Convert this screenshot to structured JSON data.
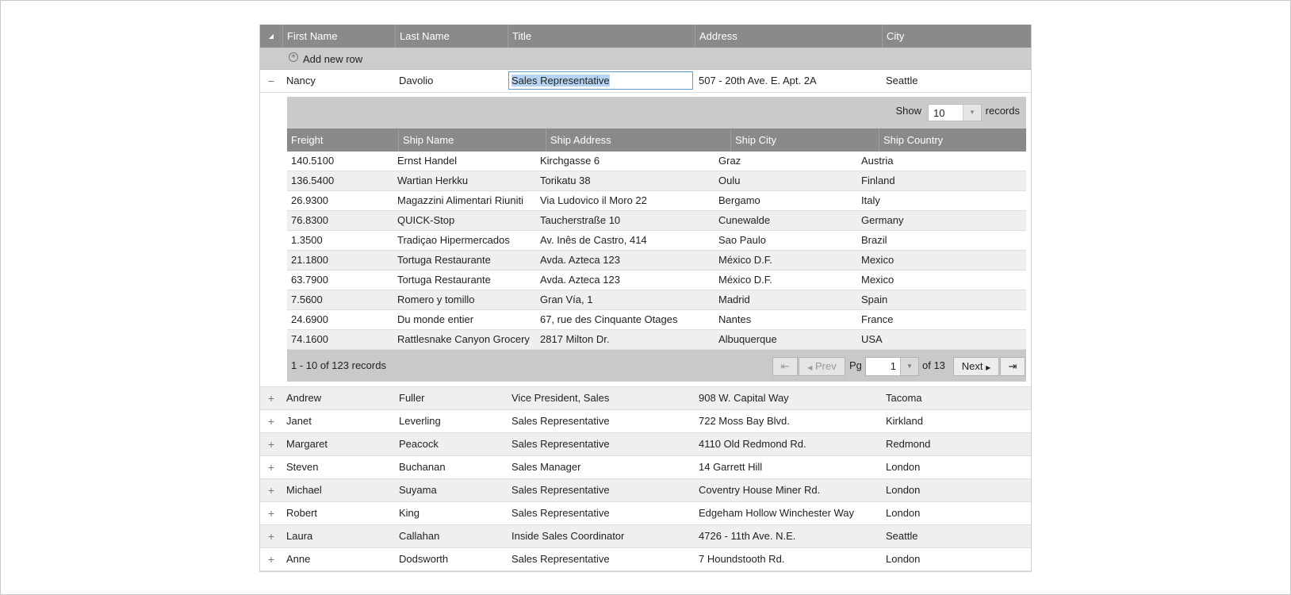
{
  "grid": {
    "columns": [
      "First Name",
      "Last Name",
      "Title",
      "Address",
      "City"
    ],
    "add_new_row": "Add new row",
    "expanded_row": {
      "first_name": "Nancy",
      "last_name": "Davolio",
      "title": "Sales Representative",
      "address": "507 - 20th Ave. E. Apt. 2A",
      "city": "Seattle"
    },
    "rows": [
      {
        "first_name": "Andrew",
        "last_name": "Fuller",
        "title": "Vice President, Sales",
        "address": "908 W. Capital Way",
        "city": "Tacoma"
      },
      {
        "first_name": "Janet",
        "last_name": "Leverling",
        "title": "Sales Representative",
        "address": "722 Moss Bay Blvd.",
        "city": "Kirkland"
      },
      {
        "first_name": "Margaret",
        "last_name": "Peacock",
        "title": "Sales Representative",
        "address": "4110 Old Redmond Rd.",
        "city": "Redmond"
      },
      {
        "first_name": "Steven",
        "last_name": "Buchanan",
        "title": "Sales Manager",
        "address": "14 Garrett Hill",
        "city": "London"
      },
      {
        "first_name": "Michael",
        "last_name": "Suyama",
        "title": "Sales Representative",
        "address": "Coventry House Miner Rd.",
        "city": "London"
      },
      {
        "first_name": "Robert",
        "last_name": "King",
        "title": "Sales Representative",
        "address": "Edgeham Hollow Winchester Way",
        "city": "London"
      },
      {
        "first_name": "Laura",
        "last_name": "Callahan",
        "title": "Inside Sales Coordinator",
        "address": "4726 - 11th Ave. N.E.",
        "city": "Seattle"
      },
      {
        "first_name": "Anne",
        "last_name": "Dodsworth",
        "title": "Sales Representative",
        "address": "7 Houndstooth Rd.",
        "city": "London"
      }
    ]
  },
  "child": {
    "show_label": "Show",
    "show_value": "10",
    "records_label": "records",
    "columns": [
      "Freight",
      "Ship Name",
      "Ship Address",
      "Ship City",
      "Ship Country"
    ],
    "rows": [
      [
        "140.5100",
        "Ernst Handel",
        "Kirchgasse 6",
        "Graz",
        "Austria"
      ],
      [
        "136.5400",
        "Wartian Herkku",
        "Torikatu 38",
        "Oulu",
        "Finland"
      ],
      [
        "26.9300",
        "Magazzini Alimentari Riuniti",
        "Via Ludovico il Moro 22",
        "Bergamo",
        "Italy"
      ],
      [
        "76.8300",
        "QUICK-Stop",
        "Taucherstraße 10",
        "Cunewalde",
        "Germany"
      ],
      [
        "1.3500",
        "Tradiçao Hipermercados",
        "Av. Inês de Castro, 414",
        "Sao Paulo",
        "Brazil"
      ],
      [
        "21.1800",
        "Tortuga Restaurante",
        "Avda. Azteca 123",
        "México D.F.",
        "Mexico"
      ],
      [
        "63.7900",
        "Tortuga Restaurante",
        "Avda. Azteca 123",
        "México D.F.",
        "Mexico"
      ],
      [
        "7.5600",
        "Romero y tomillo",
        "Gran Vía, 1",
        "Madrid",
        "Spain"
      ],
      [
        "24.6900",
        "Du monde entier",
        "67, rue des Cinquante Otages",
        "Nantes",
        "France"
      ],
      [
        "74.1600",
        "Rattlesnake Canyon Grocery",
        "2817 Milton Dr.",
        "Albuquerque",
        "USA"
      ]
    ],
    "pager": {
      "summary": "1 - 10 of 123 records",
      "prev": "Prev",
      "pg_label": "Pg",
      "page": "1",
      "of_label": "of 13",
      "next": "Next"
    }
  },
  "icons": {
    "first": "⇤",
    "last": "⇥",
    "collapse": "−",
    "expand": "+",
    "header_toggle": "◢"
  }
}
